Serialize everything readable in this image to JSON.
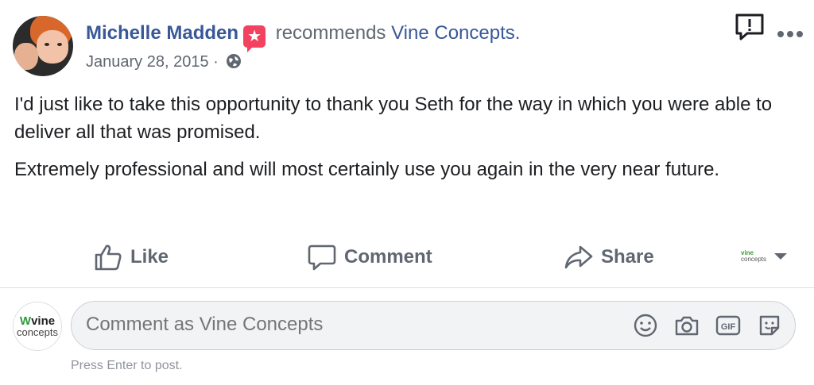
{
  "post": {
    "author_name": "Michelle Madden",
    "verb": "recommends",
    "page_name": "Vine Concepts.",
    "date": "January 28, 2015 ·",
    "body": [
      "I'd just like to take this opportunity to thank you Seth for the way in which you were able to deliver all that was promised.",
      "Extremely professional and will most certainly use you again in the very near future."
    ]
  },
  "actions": {
    "like": "Like",
    "comment": "Comment",
    "share": "Share"
  },
  "page_selector": {
    "logo_top": "vine",
    "logo_bottom": "concepts"
  },
  "composer": {
    "placeholder": "Comment as Vine Concepts",
    "logo_top": "vine",
    "logo_bottom": "concepts",
    "hint": "Press Enter to post."
  },
  "icons": {
    "recommend": "star-badge-icon",
    "privacy": "globe-icon",
    "report": "report-alert-icon",
    "more": "more-dots-icon",
    "like": "thumbs-up-icon",
    "comment": "speech-bubble-icon",
    "share": "share-arrow-icon",
    "emoji": "emoji-icon",
    "camera": "camera-icon",
    "gif": "gif-icon",
    "sticker": "sticker-icon"
  },
  "colors": {
    "link": "#385898",
    "badge": "#f3425f",
    "muted": "#606770"
  }
}
